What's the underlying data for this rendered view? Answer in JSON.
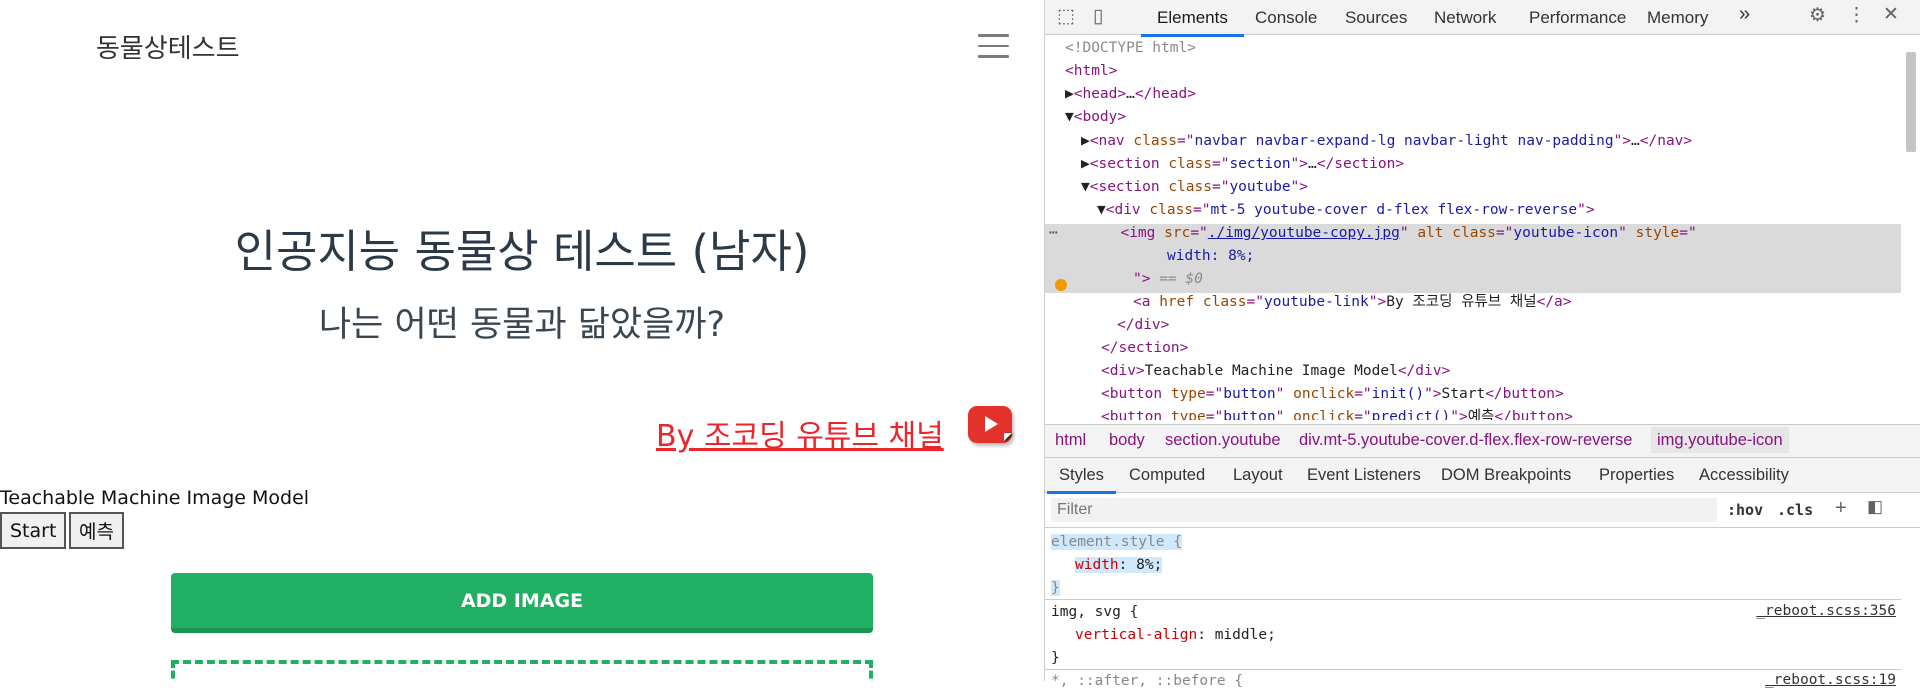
{
  "page": {
    "brand": "동물상테스트",
    "title": "인공지능 동물상 테스트 (남자)",
    "subtitle": "나는 어떤 동물과 닮았을까?",
    "youtube_link": "By 조코딩 유튜브 채널",
    "tm_label": "Teachable Machine Image Model",
    "start_button": "Start",
    "predict_button": "예측",
    "add_image_button": "ADD IMAGE"
  },
  "devtools": {
    "tabs": [
      "Elements",
      "Console",
      "Sources",
      "Network",
      "Performance",
      "Memory"
    ],
    "more_tabs": "»",
    "dom_lines": {
      "l1": "<!DOCTYPE html>",
      "l2": "<html>",
      "l3a": "<head>",
      "l3b": "…",
      "l3c": "</head>",
      "l4": "<body>",
      "l5a": "<nav ",
      "l5b": "class",
      "l5c": "=\"",
      "l5d": "navbar navbar-expand-lg navbar-light nav-padding",
      "l5e": "\">",
      "l5f": "…",
      "l5g": "</nav>",
      "l6a": "<section ",
      "l6b": "class",
      "l6d": "section",
      "l6f": "…",
      "l6g": "</section>",
      "l7a": "<section ",
      "l7b": "class",
      "l7d": "youtube",
      "l8a": "<div ",
      "l8b": "class",
      "l8d": "mt-5 youtube-cover d-flex flex-row-reverse",
      "l9a": "<img ",
      "l9b": "src",
      "l9d": "./img/youtube-copy.jpg",
      "l9e": " alt ",
      "l9f": "class",
      "l9g": "youtube-icon",
      "l9h": " style",
      "l10": "width: 8%;",
      "l11a": "\">",
      "l11b": " == $0",
      "l12a": "<a ",
      "l12b": "href ",
      "l12c": "class",
      "l12d": "youtube-link",
      "l12e": "By 조코딩 유튜브 채널",
      "l12f": "</a>",
      "l13": "</div>",
      "l14": "</section>",
      "l15a": "<div>",
      "l15b": "Teachable Machine Image Model",
      "l15c": "</div>",
      "l16a": "<button ",
      "l16b": "type",
      "l16d": "button",
      "l16e": "onclick",
      "l16f": "init()",
      "l16g": "Start",
      "l16h": "</button>",
      "l17a": "<button ",
      "l17b": "type",
      "l17d": "button",
      "l17e": "onclick",
      "l17f": "predict()",
      "l17g": "예측",
      "l17h": "</button>"
    },
    "breadcrumbs": [
      "html",
      "body",
      "section.youtube",
      "div.mt-5.youtube-cover.d-flex.flex-row-reverse",
      "img.youtube-icon"
    ],
    "subtabs": [
      "Styles",
      "Computed",
      "Layout",
      "Event Listeners",
      "DOM Breakpoints",
      "Properties",
      "Accessibility"
    ],
    "filter_placeholder": "Filter",
    "hov": ":hov",
    "cls": ".cls",
    "styles": {
      "rule1_selector": "element.style {",
      "rule1_prop": "width",
      "rule1_val": "8%;",
      "rule1_close": "}",
      "rule2_selector": "img, svg {",
      "rule2_prop": "vertical-align",
      "rule2_val": "middle;",
      "rule2_close": "}",
      "rule2_src": "_reboot.scss:356",
      "rule3_selector": "*, ::after, ::before {",
      "rule3_src": "_reboot.scss:19"
    }
  }
}
